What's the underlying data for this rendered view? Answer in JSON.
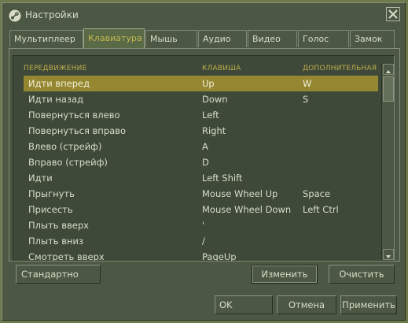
{
  "window": {
    "title": "Настройки",
    "close_label": "X"
  },
  "tabs": [
    {
      "label": "Мультиплеер"
    },
    {
      "label": "Клавиатура",
      "active": true
    },
    {
      "label": "Мышь"
    },
    {
      "label": "Аудио"
    },
    {
      "label": "Видео"
    },
    {
      "label": "Голос"
    },
    {
      "label": "Замок"
    }
  ],
  "table": {
    "headers": [
      "ПЕРЕДВИЖЕНИЕ",
      "КЛАВИША",
      "ДОПОЛНИТЕЛЬНАЯ"
    ],
    "rows": [
      {
        "action": "Идти вперед",
        "key": "Up",
        "alt": "W",
        "selected": true
      },
      {
        "action": "Идти назад",
        "key": "Down",
        "alt": "S"
      },
      {
        "action": "Повернуться влево",
        "key": "Left",
        "alt": ""
      },
      {
        "action": "Повернуться вправо",
        "key": "Right",
        "alt": ""
      },
      {
        "action": "Влево (стрейф)",
        "key": "A",
        "alt": ""
      },
      {
        "action": "Вправо (стрейф)",
        "key": "D",
        "alt": ""
      },
      {
        "action": "Идти",
        "key": "Left Shift",
        "alt": ""
      },
      {
        "action": "Прыгнуть",
        "key": "Mouse Wheel Up",
        "alt": "Space"
      },
      {
        "action": "Присесть",
        "key": "Mouse Wheel Down",
        "alt": "Left Ctrl"
      },
      {
        "action": "Плыть вверх",
        "key": "'",
        "alt": ""
      },
      {
        "action": "Плыть вниз",
        "key": "/",
        "alt": ""
      },
      {
        "action": "Смотреть вверх",
        "key": "PageUp",
        "alt": ""
      }
    ]
  },
  "buttons": {
    "default": "Стандартно",
    "edit": "Изменить",
    "clear": "Очистить",
    "ok": "OK",
    "cancel": "Отмена",
    "apply": "Применить"
  },
  "colors": {
    "accent": "#c4b550",
    "selection": "#958731",
    "panel": "#4c5844"
  }
}
